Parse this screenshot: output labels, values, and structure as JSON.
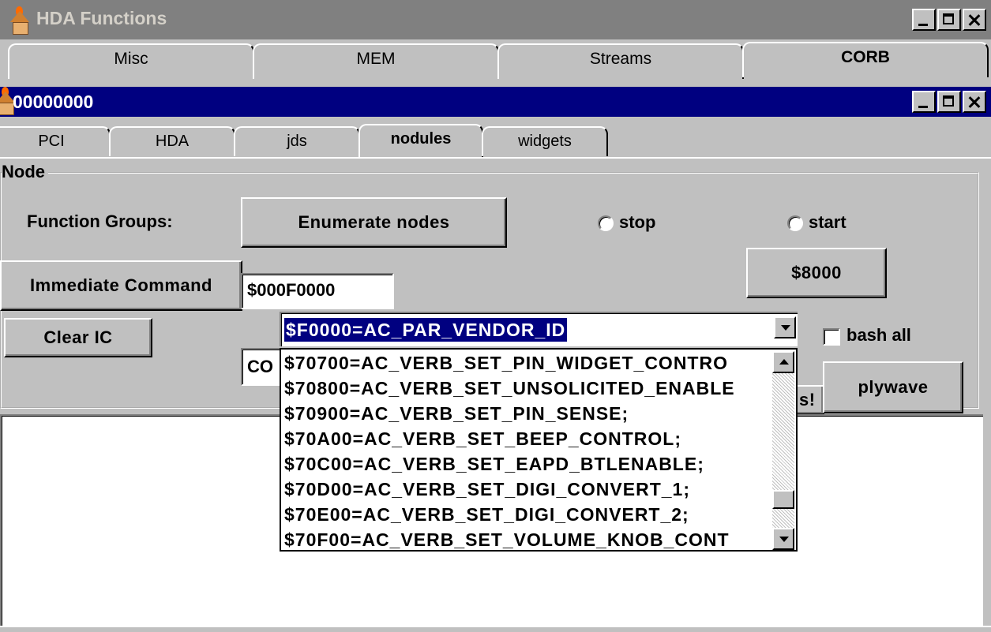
{
  "outer_window": {
    "title": "HDA Functions",
    "tabs": [
      {
        "label": "Misc"
      },
      {
        "label": "MEM"
      },
      {
        "label": "Streams"
      },
      {
        "label": "CORB"
      }
    ],
    "active_tab": "CORB"
  },
  "inner_window": {
    "title": "00000000",
    "tabs": [
      {
        "label": "PCI"
      },
      {
        "label": "HDA"
      },
      {
        "label": "jds"
      },
      {
        "label": "nodules"
      },
      {
        "label": "widgets"
      }
    ],
    "active_tab": "nodules"
  },
  "node_group": {
    "label": "Node",
    "function_groups_label": "Function Groups:",
    "enumerate_button": "Enumerate nodes",
    "stop_radio": "stop",
    "start_radio": "start",
    "hex_button": "$8000",
    "immediate_command_button": "Immediate Command",
    "immediate_command_value": "$000F0000",
    "clear_ic_button": "Clear IC",
    "partial_field_text": "CO",
    "partial_button_text": "s!",
    "bash_all_label": "bash all",
    "bash_all_checked": false,
    "plywave_button": "plywave"
  },
  "verb_combo": {
    "selected": "$F0000=AC_PAR_VENDOR_ID",
    "items": [
      "$70700=AC_VERB_SET_PIN_WIDGET_CONTRO",
      "$70800=AC_VERB_SET_UNSOLICITED_ENABLE",
      "$70900=AC_VERB_SET_PIN_SENSE;",
      "$70A00=AC_VERB_SET_BEEP_CONTROL;",
      "$70C00=AC_VERB_SET_EAPD_BTLENABLE;",
      "$70D00=AC_VERB_SET_DIGI_CONVERT_1;",
      "$70E00=AC_VERB_SET_DIGI_CONVERT_2;",
      "$70F00=AC_VERB_SET_VOLUME_KNOB_CONT"
    ]
  }
}
